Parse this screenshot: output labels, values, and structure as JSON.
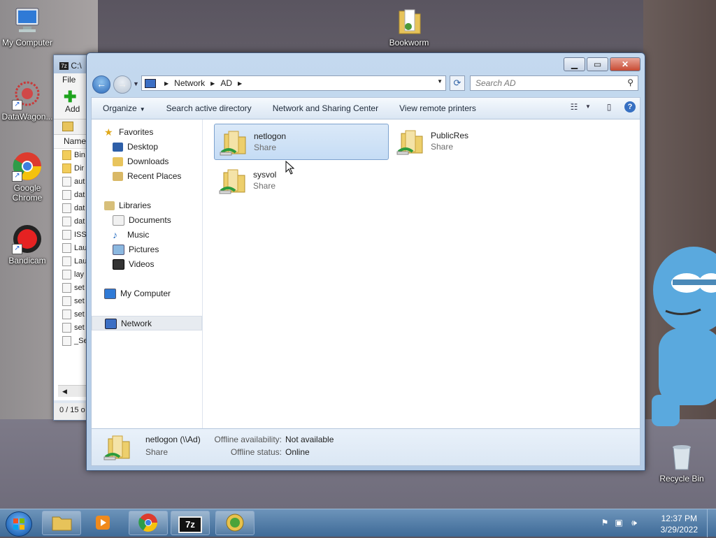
{
  "desktop": {
    "icons": [
      {
        "label": "My Computer",
        "icon": "computer-icon"
      },
      {
        "label": "Bookworm",
        "icon": "folder-icon"
      },
      {
        "label": "DataWagon...",
        "icon": "datawagon-icon"
      },
      {
        "label": "Google Chrome",
        "icon": "chrome-icon"
      },
      {
        "label": "Bandicam",
        "icon": "bandicam-icon"
      },
      {
        "label": "Recycle Bin",
        "icon": "recycle-bin-icon"
      }
    ]
  },
  "sevenzip": {
    "title": "C:\\",
    "menu_file": "File",
    "add_label": "Add",
    "column_name": "Name",
    "rows": [
      "Bin",
      "Dir",
      "aut",
      "dat",
      "dat",
      "dat",
      "ISS",
      "Lau",
      "Lau",
      "lay",
      "set",
      "set",
      "set",
      "set",
      "_Se"
    ],
    "status": "0 / 15 o"
  },
  "explorer": {
    "breadcrumb": [
      "Network",
      "AD"
    ],
    "search_placeholder": "Search AD",
    "commands": {
      "organize": "Organize",
      "search_ad": "Search active directory",
      "network_center": "Network and Sharing Center",
      "remote_printers": "View remote printers"
    },
    "nav": {
      "favorites": "Favorites",
      "desktop": "Desktop",
      "downloads": "Downloads",
      "recent": "Recent Places",
      "libraries": "Libraries",
      "documents": "Documents",
      "music": "Music",
      "pictures": "Pictures",
      "videos": "Videos",
      "my_computer": "My Computer",
      "network": "Network"
    },
    "items": [
      {
        "name": "netlogon",
        "type": "Share",
        "selected": true
      },
      {
        "name": "PublicRes",
        "type": "Share",
        "selected": false
      },
      {
        "name": "sysvol",
        "type": "Share",
        "selected": false
      }
    ],
    "details": {
      "name": "netlogon (\\\\Ad)",
      "type": "Share",
      "offline_availability_label": "Offline availability:",
      "offline_availability_value": "Not available",
      "offline_status_label": "Offline status:",
      "offline_status_value": "Online"
    }
  },
  "taskbar": {
    "time": "12:37 PM",
    "date": "3/29/2022",
    "sevenzip_label": "7z"
  }
}
